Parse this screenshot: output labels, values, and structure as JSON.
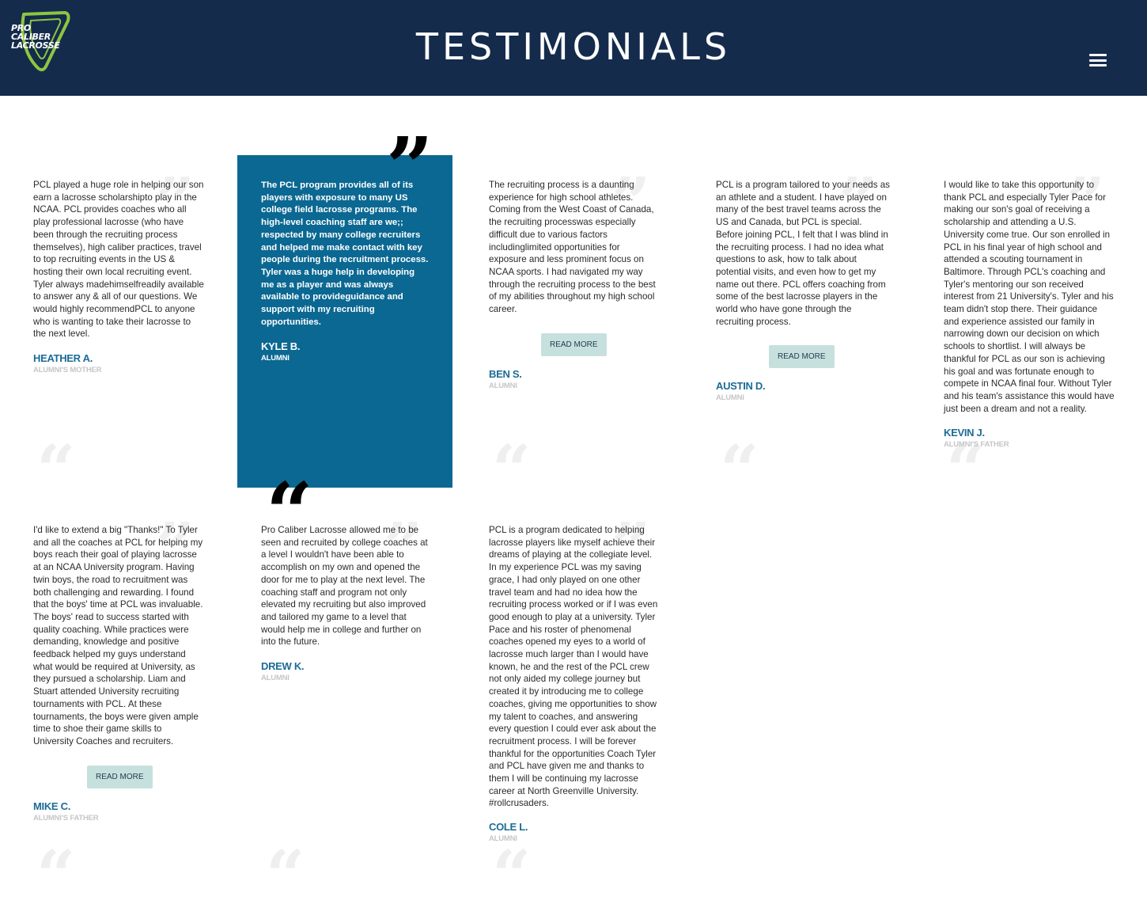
{
  "header": {
    "title": "TESTIMONIALS",
    "logo_lines": [
      "PRO",
      "CALIBER",
      "LACROSSE"
    ],
    "brand_color": "#142b4c",
    "accent_color": "#8dc63f",
    "menu_icon": "hamburger-icon"
  },
  "testimonials": [
    {
      "body": "PCL played a huge role in helping our son earn a lacrosse scholarshipto play in the NCAA. PCL provides coaches who all play professional lacrosse (who have been through the recruiting process themselves), high caliber practices, travel to top recruiting events in the US & hosting their own local recruiting event. Tyler always madehimselfreadily available to answer any & all of our questions. We would highly recommendPCL to anyone who is wanting to take their lacrosse to the next level.",
      "name": "HEATHER A.",
      "role": "ALUMNI'S MOTHER"
    },
    {
      "body": "The PCL program provides all of its players with exposure to many US college field lacrosse programs. The high-level coaching staff are we;; respected by many college recruiters and helped me make contact with key people during the recruitment process. Tyler was a huge help in developing me as a player and was always available to provideguidance and support with my recruiting opportunities.",
      "name": "KYLE B.",
      "role": "ALUMNI"
    },
    {
      "body": "The recruiting process is a daunting experience for high school athletes. Coming from the West Coast of Canada, the recruiting processwas especially difficult due to various factors includinglimited opportunities for exposure and less prominent focus on NCAA sports. I had navigated my way through the recruiting process to the best of my abilities throughout my high school career.",
      "read_more": "READ MORE",
      "name": "BEN S.",
      "role": "ALUMNI"
    },
    {
      "body": "PCL is a program tailored to your needs as an athlete and a student. I have played on many of the best travel teams across the US and Canada, but PCL is special. Before joining PCL, I felt that I was blind in the recruiting process. I had no idea what questions to ask, how to talk about potential visits, and even how to get my name out there. PCL offers coaching from some of the best lacrosse players in the world who have gone through the recruiting process.",
      "read_more": "READ MORE",
      "name": "AUSTIN D.",
      "role": "ALUMNI"
    },
    {
      "body": "I would like to take this opportunity to thank PCL and especially Tyler Pace for making our son's goal of receiving a scholarship and attending a U.S. University come true. Our son enrolled in PCL in his final year of high school and attended a scouting tournament in Baltimore. Through PCL's coaching and Tyler's mentoring our son received interest from 21 University's. Tyler and his team didn't stop there. Their guidance and experience assisted our family in narrowing down our decision on which schools to shortlist. I will always be thankful for PCL as our son is achieving his goal and was fortunate enough to compete in NCAA final four. Without Tyler and his team's assistance this would have just been a dream and not a reality.",
      "name": "KEVIN J.",
      "role": "ALUMNI'S FATHER"
    },
    {
      "body": "I'd like to extend a big \"Thanks!\" To Tyler and all the coaches at PCL for helping my boys reach their goal of playing lacrosse at an NCAA University program. Having twin boys, the road to recruitment was both challenging and rewarding. I found that the boys' time at PCL was invaluable. The boys' read to success started with quality coaching. While practices were demanding, knowledge and positive feedback helped my guys understand what would be required at University, as they pursued a scholarship. Liam and Stuart attended University recruiting tournaments with PCL. At these tournaments, the boys were given ample time to shoe their game skills to University Coaches and recruiters.",
      "read_more": "READ MORE",
      "name": "MIKE C.",
      "role": "ALUMNI'S FATHER"
    },
    {
      "body": "Pro Caliber Lacrosse allowed me to be seen and recruited by college coaches at a level I wouldn't have been able to accomplish on my own and opened the door for me to play at the next level. The coaching staff and program not only elevated my recruiting but also improved and tailored my game to a level that would help me in college and further on into the future.",
      "name": "DREW K.",
      "role": "ALUMNI"
    },
    {
      "body": "PCL is a program dedicated to helping lacrosse players like myself achieve their dreams of playing at the collegiate level. In my experience PCL was my saving grace, I had only played on one other travel team and had no idea how the recruiting process worked or if I was even good enough to play at a university. Tyler Pace and his roster of phenomenal coaches opened my eyes to a world of lacrosse much larger than I would have known, he and the rest of the PCL crew not only aided my college journey but created it by introducing me to college coaches, giving me opportunities to show my talent to coaches, and answering every question I could ever ask about the recruitment process. I will be forever thankful for the opportunities Coach Tyler and PCL have given me and thanks to them I will be continuing my lacrosse career at North Greenville University. #rollcrusaders.",
      "name": "COLE L.",
      "role": "ALUMNI"
    }
  ]
}
